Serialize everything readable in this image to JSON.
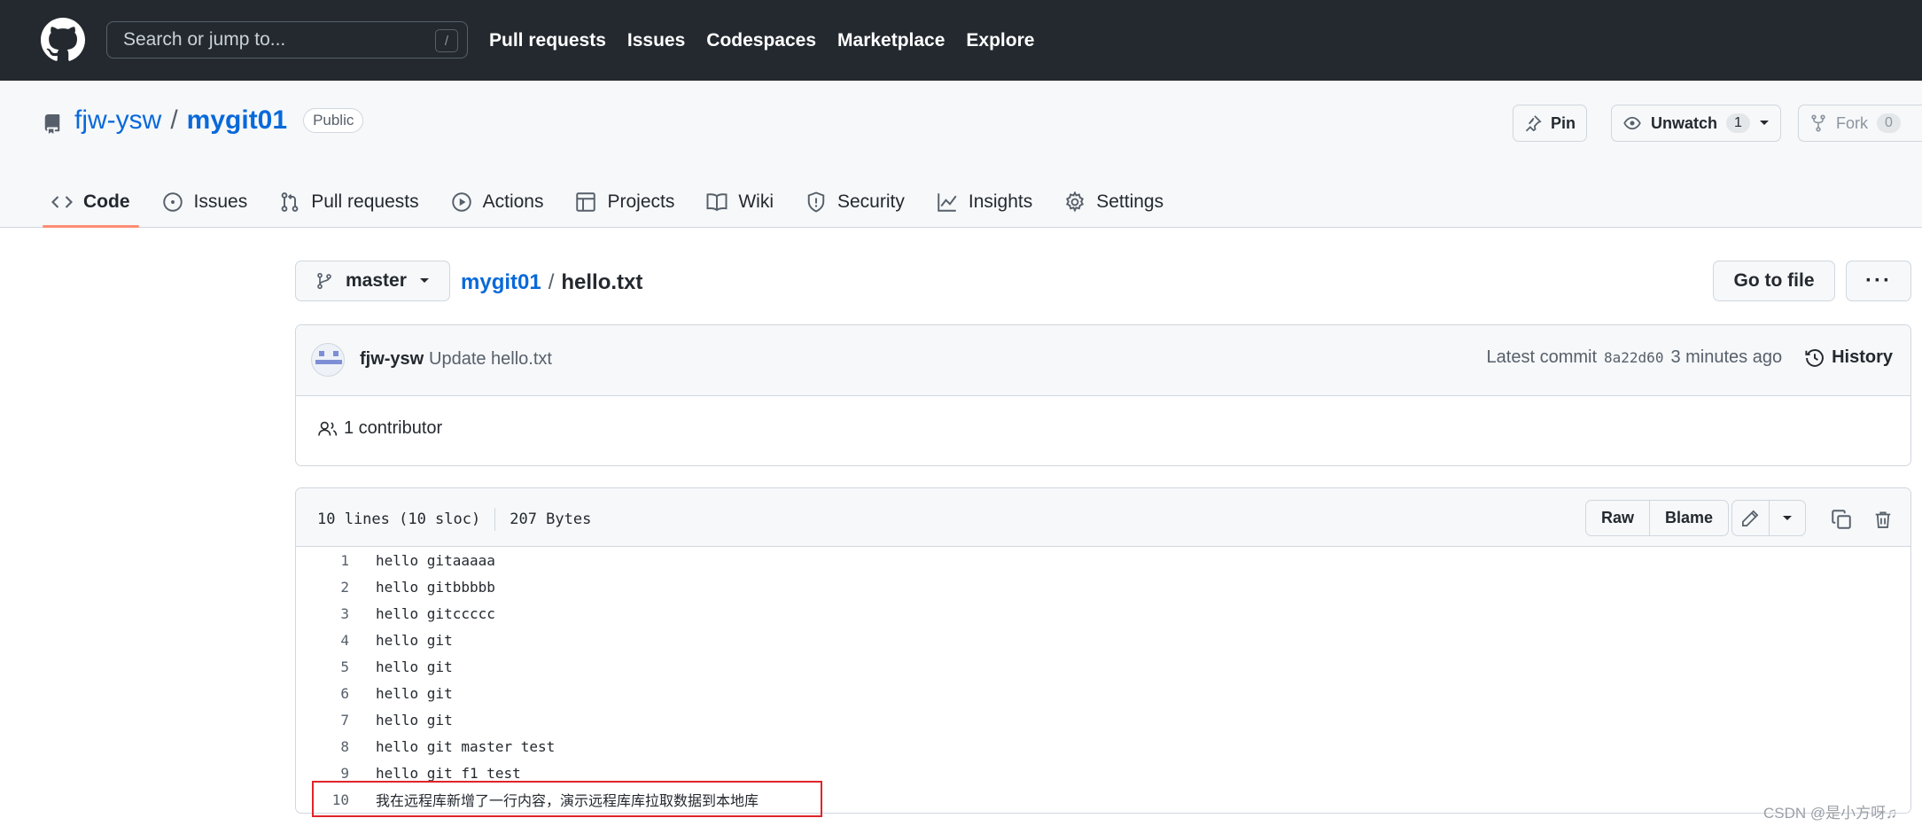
{
  "header": {
    "search_placeholder": "Search or jump to...",
    "search_shortcut": "/",
    "nav": [
      "Pull requests",
      "Issues",
      "Codespaces",
      "Marketplace",
      "Explore"
    ]
  },
  "repo": {
    "owner": "fjw-ysw",
    "separator": "/",
    "name": "mygit01",
    "visibility": "Public",
    "pin_label": "Pin",
    "unwatch_label": "Unwatch",
    "watch_count": "1",
    "fork_label": "Fork",
    "fork_count": "0"
  },
  "tabs": [
    {
      "label": "Code",
      "icon": "code-icon",
      "active": true
    },
    {
      "label": "Issues",
      "icon": "issue-icon"
    },
    {
      "label": "Pull requests",
      "icon": "pull-request-icon"
    },
    {
      "label": "Actions",
      "icon": "play-icon"
    },
    {
      "label": "Projects",
      "icon": "table-icon"
    },
    {
      "label": "Wiki",
      "icon": "book-icon"
    },
    {
      "label": "Security",
      "icon": "shield-icon"
    },
    {
      "label": "Insights",
      "icon": "graph-icon"
    },
    {
      "label": "Settings",
      "icon": "gear-icon"
    }
  ],
  "file_nav": {
    "branch": "master",
    "repo_link": "mygit01",
    "separator": "/",
    "file_name": "hello.txt",
    "goto_label": "Go to file",
    "more_label": "···"
  },
  "commit": {
    "author": "fjw-ysw",
    "message": "Update hello.txt",
    "latest_label": "Latest commit",
    "sha": "8a22d60",
    "time": "3 minutes ago",
    "history_label": "History",
    "contributors": "1 contributor"
  },
  "file": {
    "lines_info": "10 lines (10 sloc)",
    "size": "207 Bytes",
    "raw_label": "Raw",
    "blame_label": "Blame",
    "lines": [
      {
        "n": "1",
        "t": "hello gitaaaaa"
      },
      {
        "n": "2",
        "t": "hello gitbbbbb"
      },
      {
        "n": "3",
        "t": "hello gitccccc"
      },
      {
        "n": "4",
        "t": "hello git"
      },
      {
        "n": "5",
        "t": "hello git"
      },
      {
        "n": "6",
        "t": "hello git"
      },
      {
        "n": "7",
        "t": "hello git"
      },
      {
        "n": "8",
        "t": "hello git master test"
      },
      {
        "n": "9",
        "t": "hello git f1 test"
      },
      {
        "n": "10",
        "t": "我在远程库新增了一行内容，演示远程库库拉取数据到本地库"
      }
    ]
  },
  "watermark": "CSDN @是小方呀♫",
  "colors": {
    "header_bg": "#24292f",
    "link": "#0969da",
    "active_tab_underline": "#fd8c73",
    "highlight_box": "#e0252a"
  }
}
